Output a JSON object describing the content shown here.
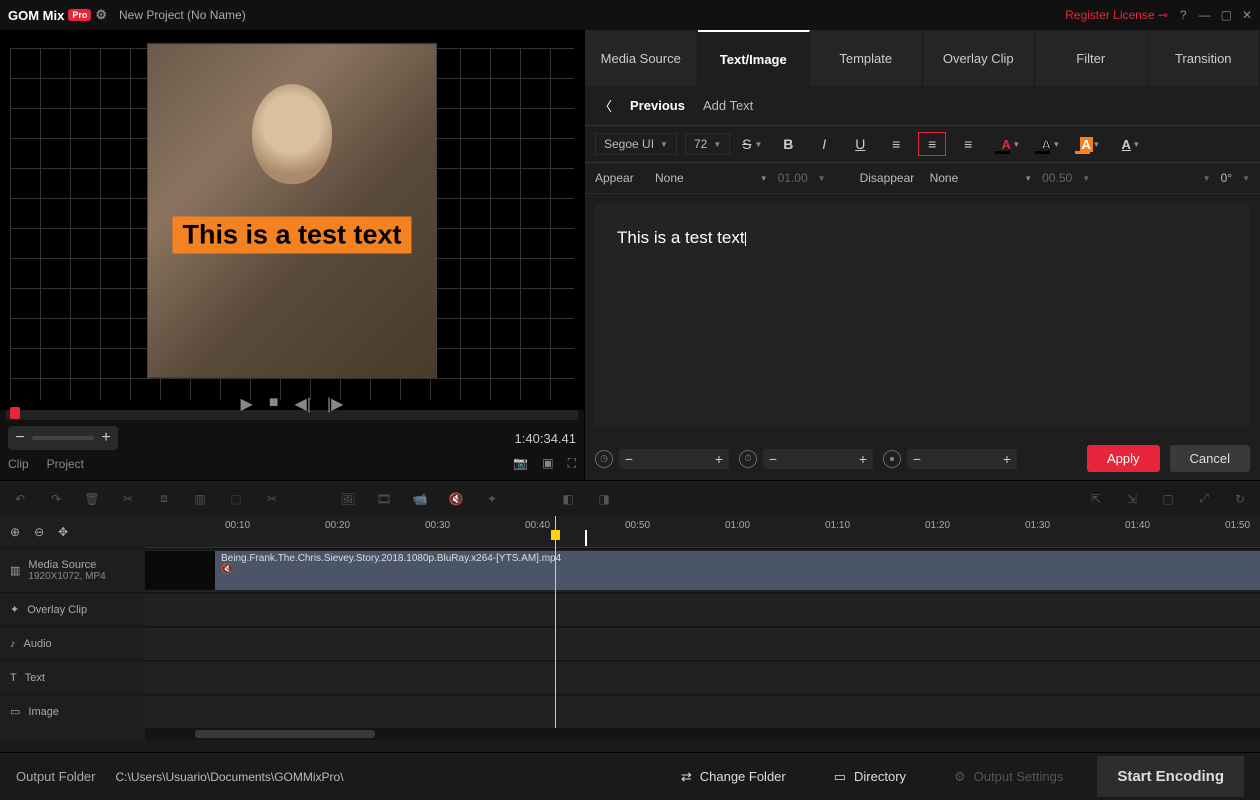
{
  "titlebar": {
    "logo_text": "GOM Mix",
    "pro_badge": "Pro",
    "project_name": "New Project (No Name)",
    "register": "Register License"
  },
  "preview": {
    "overlay_text": "This is a test text",
    "timecode": "1:40:34.41",
    "clip_label": "Clip",
    "project_label": "Project"
  },
  "tabs": [
    "Media Source",
    "Text/Image",
    "Template",
    "Overlay Clip",
    "Filter",
    "Transition"
  ],
  "active_tab_index": 1,
  "subheader": {
    "previous": "Previous",
    "add_text": "Add Text"
  },
  "format": {
    "font": "Segoe UI",
    "size": "72",
    "strike": "S",
    "bold": "B",
    "italic": "I",
    "underline": "U"
  },
  "anim": {
    "appear_label": "Appear",
    "appear_value": "None",
    "appear_time": "01.00",
    "disappear_label": "Disappear",
    "disappear_value": "None",
    "disappear_time": "00.50",
    "angle": "0°"
  },
  "textarea_content": "This is a test text",
  "actions": {
    "apply": "Apply",
    "cancel": "Cancel"
  },
  "timeline": {
    "ticks": [
      "00:10",
      "00:20",
      "00:30",
      "00:40",
      "00:50",
      "01:00",
      "01:10",
      "01:20",
      "01:30",
      "01:40",
      "01:50"
    ],
    "tracks": {
      "media": {
        "label": "Media Source",
        "sub": "1920X1072, MP4"
      },
      "overlay": "Overlay Clip",
      "audio": "Audio",
      "text": "Text",
      "image": "Image"
    },
    "clip_name": "Being.Frank.The.Chris.Sievey.Story.2018.1080p.BluRay.x264-[YTS.AM].mp4"
  },
  "statusbar": {
    "output_label": "Output Folder",
    "output_path": "C:\\Users\\Usuario\\Documents\\GOMMixPro\\",
    "change_folder": "Change Folder",
    "directory": "Directory",
    "output_settings": "Output Settings",
    "start_encoding": "Start Encoding"
  }
}
